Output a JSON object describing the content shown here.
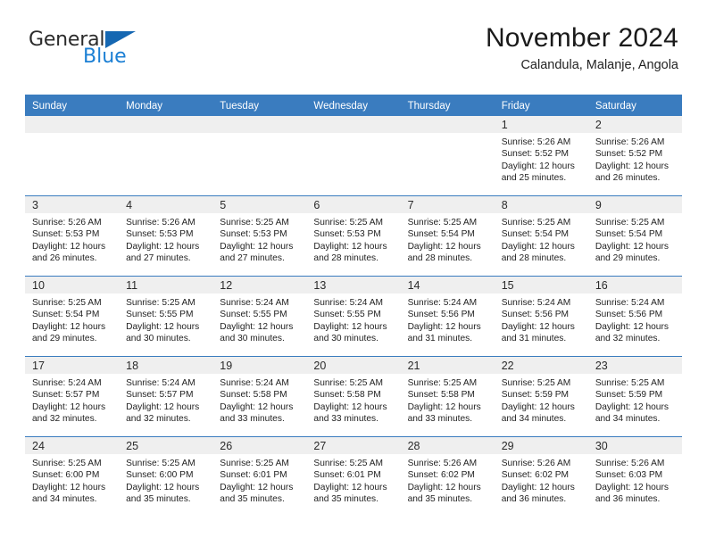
{
  "logo": {
    "word_top": "General",
    "word_bottom": "Blue",
    "triangle_color": "#1567b2",
    "blue_color": "#1b7fd4"
  },
  "header": {
    "title": "November 2024",
    "subtitle": "Calandula, Malanje, Angola"
  },
  "theme": {
    "header_row_bg": "#3a7cbf",
    "cell_band_bg": "#efefef",
    "cell_border": "#3a7cbf"
  },
  "weekdays": [
    "Sunday",
    "Monday",
    "Tuesday",
    "Wednesday",
    "Thursday",
    "Friday",
    "Saturday"
  ],
  "weeks": [
    [
      {
        "day": "",
        "empty": true
      },
      {
        "day": "",
        "empty": true
      },
      {
        "day": "",
        "empty": true
      },
      {
        "day": "",
        "empty": true
      },
      {
        "day": "",
        "empty": true
      },
      {
        "day": "1",
        "sunrise": "Sunrise: 5:26 AM",
        "sunset": "Sunset: 5:52 PM",
        "daylight1": "Daylight: 12 hours",
        "daylight2": "and 25 minutes."
      },
      {
        "day": "2",
        "sunrise": "Sunrise: 5:26 AM",
        "sunset": "Sunset: 5:52 PM",
        "daylight1": "Daylight: 12 hours",
        "daylight2": "and 26 minutes."
      }
    ],
    [
      {
        "day": "3",
        "sunrise": "Sunrise: 5:26 AM",
        "sunset": "Sunset: 5:53 PM",
        "daylight1": "Daylight: 12 hours",
        "daylight2": "and 26 minutes."
      },
      {
        "day": "4",
        "sunrise": "Sunrise: 5:26 AM",
        "sunset": "Sunset: 5:53 PM",
        "daylight1": "Daylight: 12 hours",
        "daylight2": "and 27 minutes."
      },
      {
        "day": "5",
        "sunrise": "Sunrise: 5:25 AM",
        "sunset": "Sunset: 5:53 PM",
        "daylight1": "Daylight: 12 hours",
        "daylight2": "and 27 minutes."
      },
      {
        "day": "6",
        "sunrise": "Sunrise: 5:25 AM",
        "sunset": "Sunset: 5:53 PM",
        "daylight1": "Daylight: 12 hours",
        "daylight2": "and 28 minutes."
      },
      {
        "day": "7",
        "sunrise": "Sunrise: 5:25 AM",
        "sunset": "Sunset: 5:54 PM",
        "daylight1": "Daylight: 12 hours",
        "daylight2": "and 28 minutes."
      },
      {
        "day": "8",
        "sunrise": "Sunrise: 5:25 AM",
        "sunset": "Sunset: 5:54 PM",
        "daylight1": "Daylight: 12 hours",
        "daylight2": "and 28 minutes."
      },
      {
        "day": "9",
        "sunrise": "Sunrise: 5:25 AM",
        "sunset": "Sunset: 5:54 PM",
        "daylight1": "Daylight: 12 hours",
        "daylight2": "and 29 minutes."
      }
    ],
    [
      {
        "day": "10",
        "sunrise": "Sunrise: 5:25 AM",
        "sunset": "Sunset: 5:54 PM",
        "daylight1": "Daylight: 12 hours",
        "daylight2": "and 29 minutes."
      },
      {
        "day": "11",
        "sunrise": "Sunrise: 5:25 AM",
        "sunset": "Sunset: 5:55 PM",
        "daylight1": "Daylight: 12 hours",
        "daylight2": "and 30 minutes."
      },
      {
        "day": "12",
        "sunrise": "Sunrise: 5:24 AM",
        "sunset": "Sunset: 5:55 PM",
        "daylight1": "Daylight: 12 hours",
        "daylight2": "and 30 minutes."
      },
      {
        "day": "13",
        "sunrise": "Sunrise: 5:24 AM",
        "sunset": "Sunset: 5:55 PM",
        "daylight1": "Daylight: 12 hours",
        "daylight2": "and 30 minutes."
      },
      {
        "day": "14",
        "sunrise": "Sunrise: 5:24 AM",
        "sunset": "Sunset: 5:56 PM",
        "daylight1": "Daylight: 12 hours",
        "daylight2": "and 31 minutes."
      },
      {
        "day": "15",
        "sunrise": "Sunrise: 5:24 AM",
        "sunset": "Sunset: 5:56 PM",
        "daylight1": "Daylight: 12 hours",
        "daylight2": "and 31 minutes."
      },
      {
        "day": "16",
        "sunrise": "Sunrise: 5:24 AM",
        "sunset": "Sunset: 5:56 PM",
        "daylight1": "Daylight: 12 hours",
        "daylight2": "and 32 minutes."
      }
    ],
    [
      {
        "day": "17",
        "sunrise": "Sunrise: 5:24 AM",
        "sunset": "Sunset: 5:57 PM",
        "daylight1": "Daylight: 12 hours",
        "daylight2": "and 32 minutes."
      },
      {
        "day": "18",
        "sunrise": "Sunrise: 5:24 AM",
        "sunset": "Sunset: 5:57 PM",
        "daylight1": "Daylight: 12 hours",
        "daylight2": "and 32 minutes."
      },
      {
        "day": "19",
        "sunrise": "Sunrise: 5:24 AM",
        "sunset": "Sunset: 5:58 PM",
        "daylight1": "Daylight: 12 hours",
        "daylight2": "and 33 minutes."
      },
      {
        "day": "20",
        "sunrise": "Sunrise: 5:25 AM",
        "sunset": "Sunset: 5:58 PM",
        "daylight1": "Daylight: 12 hours",
        "daylight2": "and 33 minutes."
      },
      {
        "day": "21",
        "sunrise": "Sunrise: 5:25 AM",
        "sunset": "Sunset: 5:58 PM",
        "daylight1": "Daylight: 12 hours",
        "daylight2": "and 33 minutes."
      },
      {
        "day": "22",
        "sunrise": "Sunrise: 5:25 AM",
        "sunset": "Sunset: 5:59 PM",
        "daylight1": "Daylight: 12 hours",
        "daylight2": "and 34 minutes."
      },
      {
        "day": "23",
        "sunrise": "Sunrise: 5:25 AM",
        "sunset": "Sunset: 5:59 PM",
        "daylight1": "Daylight: 12 hours",
        "daylight2": "and 34 minutes."
      }
    ],
    [
      {
        "day": "24",
        "sunrise": "Sunrise: 5:25 AM",
        "sunset": "Sunset: 6:00 PM",
        "daylight1": "Daylight: 12 hours",
        "daylight2": "and 34 minutes."
      },
      {
        "day": "25",
        "sunrise": "Sunrise: 5:25 AM",
        "sunset": "Sunset: 6:00 PM",
        "daylight1": "Daylight: 12 hours",
        "daylight2": "and 35 minutes."
      },
      {
        "day": "26",
        "sunrise": "Sunrise: 5:25 AM",
        "sunset": "Sunset: 6:01 PM",
        "daylight1": "Daylight: 12 hours",
        "daylight2": "and 35 minutes."
      },
      {
        "day": "27",
        "sunrise": "Sunrise: 5:25 AM",
        "sunset": "Sunset: 6:01 PM",
        "daylight1": "Daylight: 12 hours",
        "daylight2": "and 35 minutes."
      },
      {
        "day": "28",
        "sunrise": "Sunrise: 5:26 AM",
        "sunset": "Sunset: 6:02 PM",
        "daylight1": "Daylight: 12 hours",
        "daylight2": "and 35 minutes."
      },
      {
        "day": "29",
        "sunrise": "Sunrise: 5:26 AM",
        "sunset": "Sunset: 6:02 PM",
        "daylight1": "Daylight: 12 hours",
        "daylight2": "and 36 minutes."
      },
      {
        "day": "30",
        "sunrise": "Sunrise: 5:26 AM",
        "sunset": "Sunset: 6:03 PM",
        "daylight1": "Daylight: 12 hours",
        "daylight2": "and 36 minutes."
      }
    ]
  ]
}
